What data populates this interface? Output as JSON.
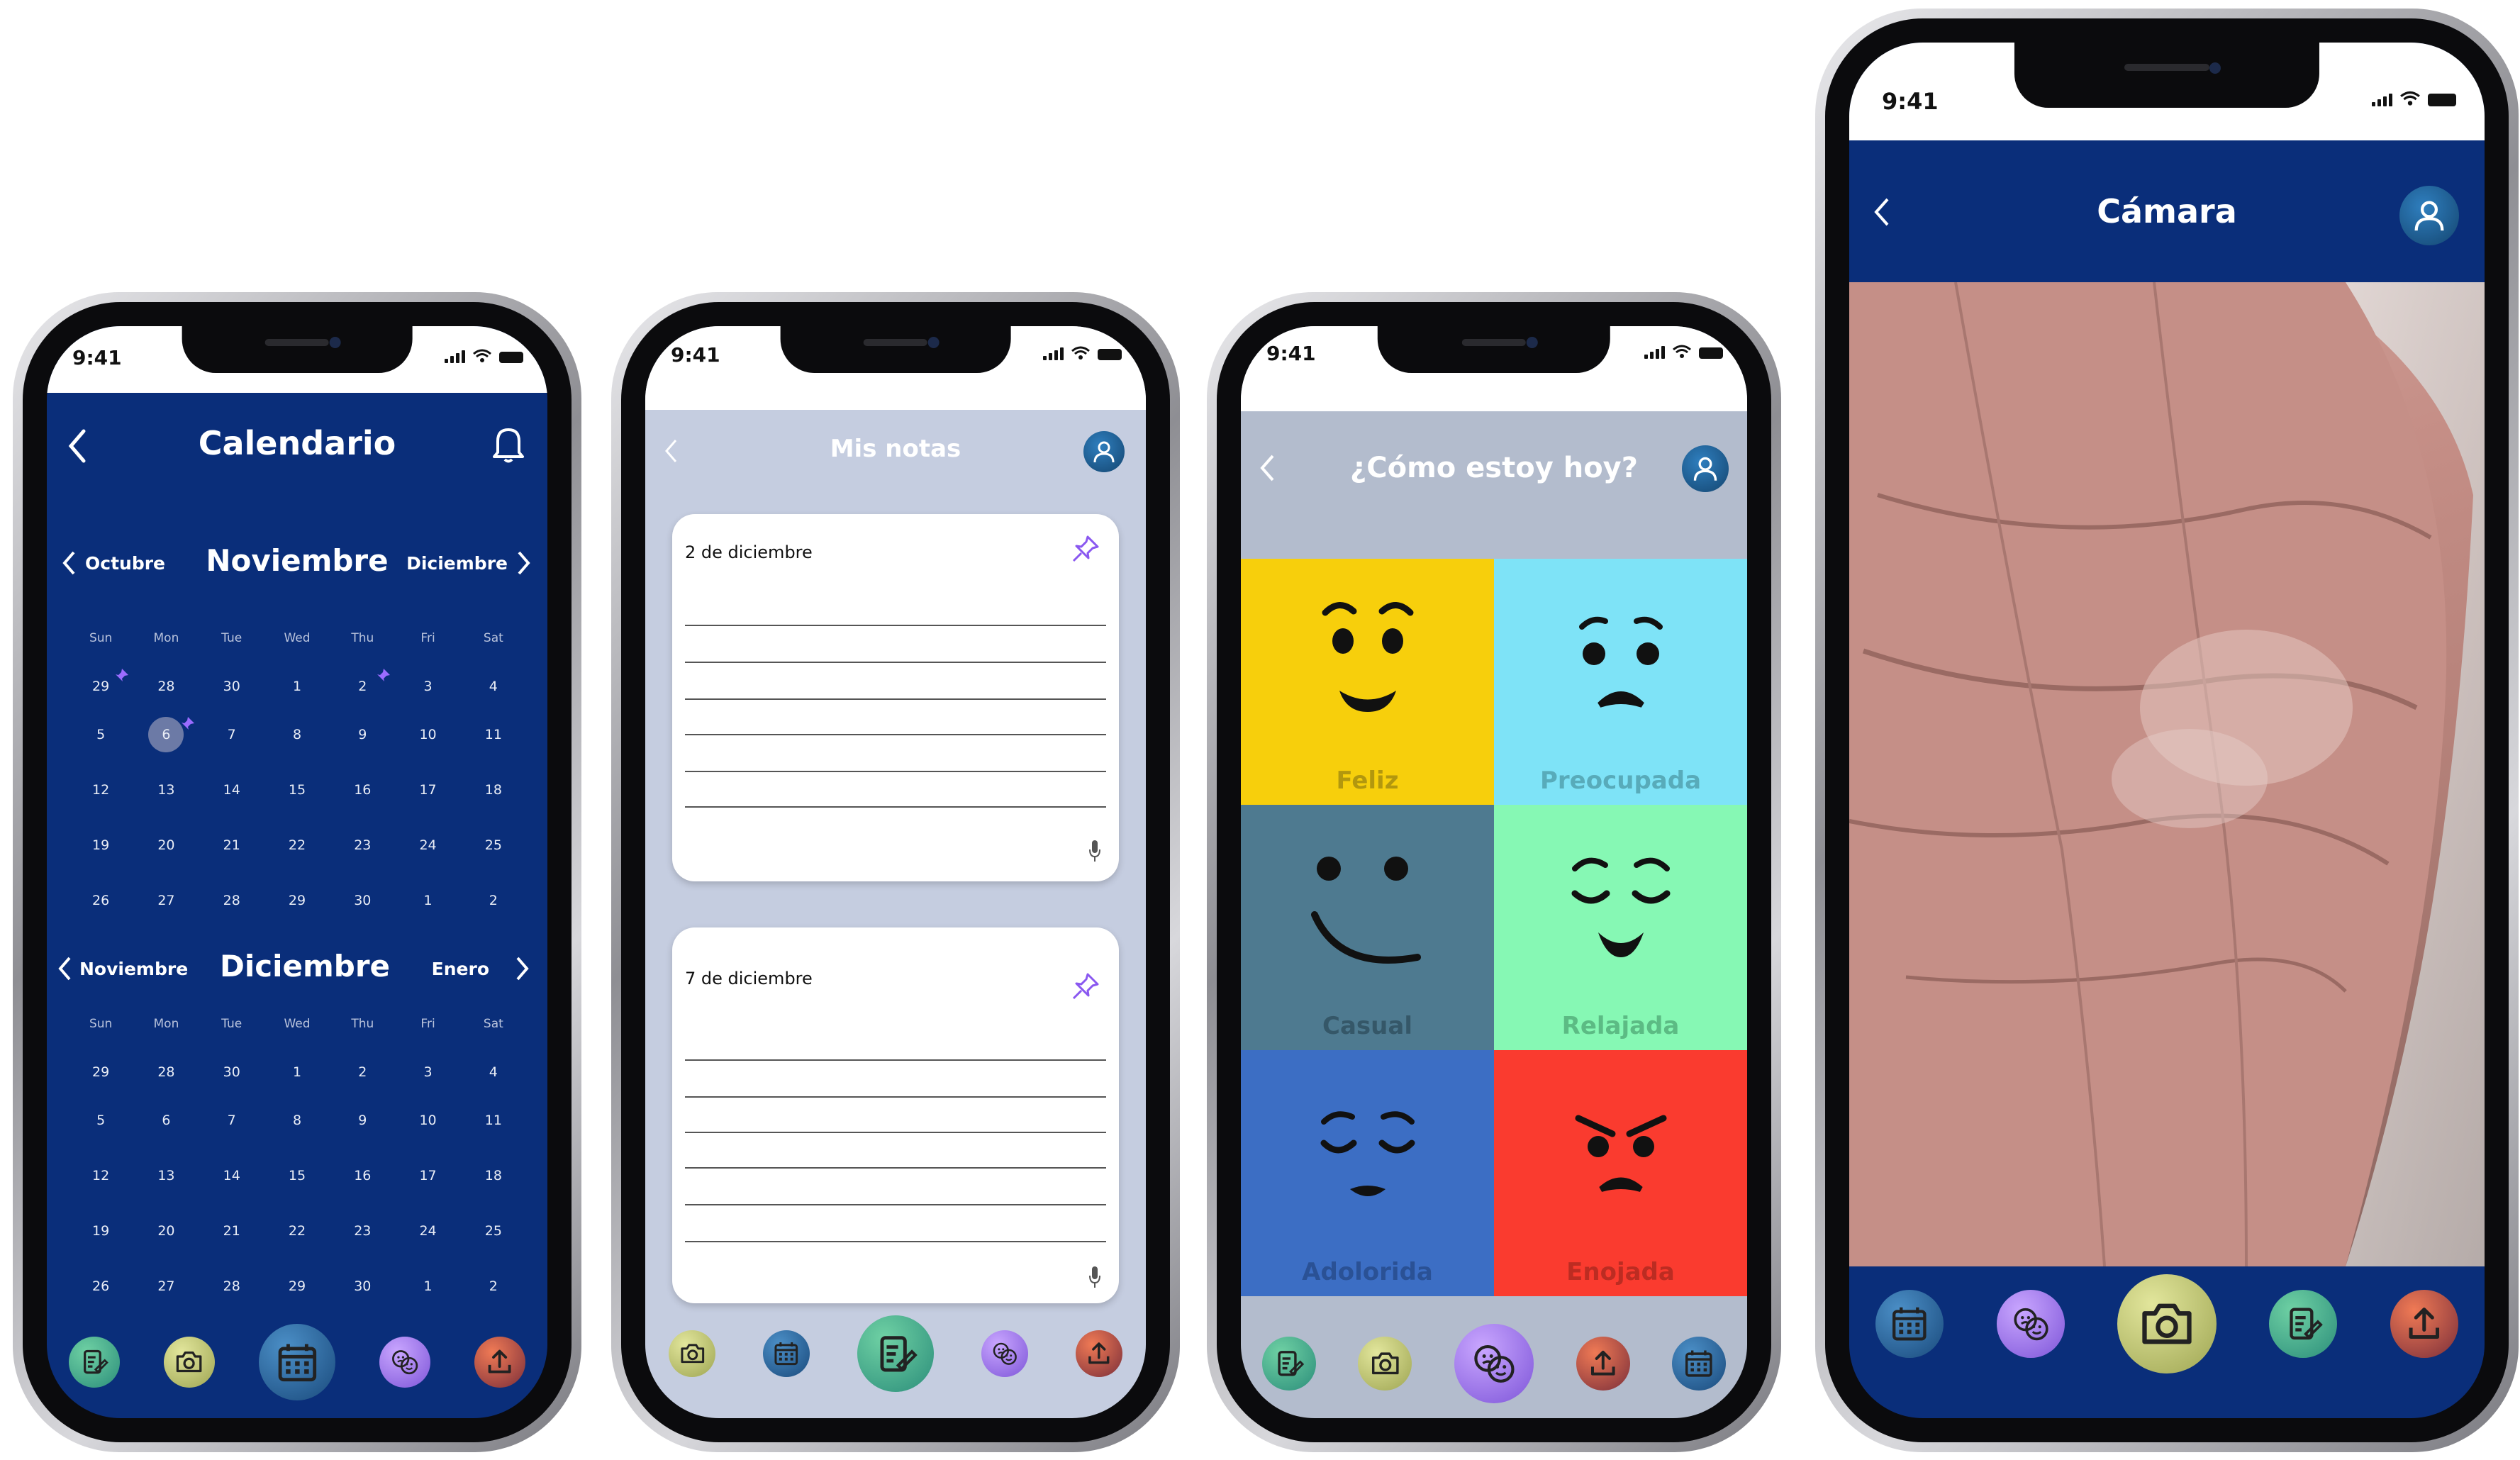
{
  "status_bar": {
    "time": "9:41"
  },
  "colors": {
    "navy": "#0a2e7a",
    "notes_bg": "#c5cde0",
    "mood_header": "#b3bccd"
  },
  "calendar_screen": {
    "title": "Calendario",
    "icons": {
      "back": "chevron-left-icon",
      "notifications": "bell-icon"
    },
    "weekday_headers": [
      "Sun",
      "Mon",
      "Tue",
      "Wed",
      "Thu",
      "Fri",
      "Sat"
    ],
    "months": [
      {
        "current": "Noviembre",
        "prev": "Octubre",
        "next": "Diciembre",
        "weeks": [
          [
            "29",
            "28",
            "30",
            "1",
            "2",
            "3",
            "4"
          ],
          [
            "5",
            "6",
            "7",
            "8",
            "9",
            "10",
            "11"
          ],
          [
            "12",
            "13",
            "14",
            "15",
            "16",
            "17",
            "18"
          ],
          [
            "19",
            "20",
            "21",
            "22",
            "23",
            "24",
            "25"
          ],
          [
            "26",
            "27",
            "28",
            "29",
            "30",
            "1",
            "2"
          ]
        ]
      },
      {
        "current": "Diciembre",
        "prev": "Noviembre",
        "next": "Enero",
        "weeks": [
          [
            "29",
            "28",
            "30",
            "1",
            "2",
            "3",
            "4"
          ],
          [
            "5",
            "6",
            "7",
            "8",
            "9",
            "10",
            "11"
          ],
          [
            "12",
            "13",
            "14",
            "15",
            "16",
            "17",
            "18"
          ],
          [
            "19",
            "20",
            "21",
            "22",
            "23",
            "24",
            "25"
          ],
          [
            "26",
            "27",
            "28",
            "29",
            "30",
            "1",
            "2"
          ]
        ]
      }
    ],
    "nav_icons": [
      "notes-icon",
      "camera-icon",
      "calendar-icon",
      "mood-icon",
      "upload-icon"
    ],
    "active_nav": "calendar-icon"
  },
  "notes_screen": {
    "title": "Mis notas",
    "notes": [
      {
        "date": "2 de diciembre"
      },
      {
        "date": "7 de diciembre"
      }
    ],
    "nav_icons": [
      "camera-icon",
      "calendar-icon",
      "notes-icon",
      "mood-icon",
      "upload-icon"
    ],
    "active_nav": "notes-icon"
  },
  "mood_screen": {
    "title": "¿Cómo estoy hoy?",
    "moods": [
      {
        "label": "Feliz",
        "color": "#f7cf0c"
      },
      {
        "label": "Preocupada",
        "color": "#7ee3f7"
      },
      {
        "label": "Casual",
        "color": "#4e7a90"
      },
      {
        "label": "Relajada",
        "color": "#86f8b4"
      },
      {
        "label": "Adolorida",
        "color": "#3c6ec4"
      },
      {
        "label": "Enojada",
        "color": "#fa3b2f"
      }
    ],
    "nav_icons": [
      "notes-icon",
      "camera-icon",
      "mood-icon",
      "upload-icon",
      "calendar-icon"
    ],
    "active_nav": "mood-icon"
  },
  "camera_screen": {
    "title": "Cámara",
    "nav_icons": [
      "calendar-icon",
      "mood-icon",
      "camera-icon",
      "notes-icon",
      "upload-icon"
    ],
    "active_nav": "camera-icon"
  }
}
